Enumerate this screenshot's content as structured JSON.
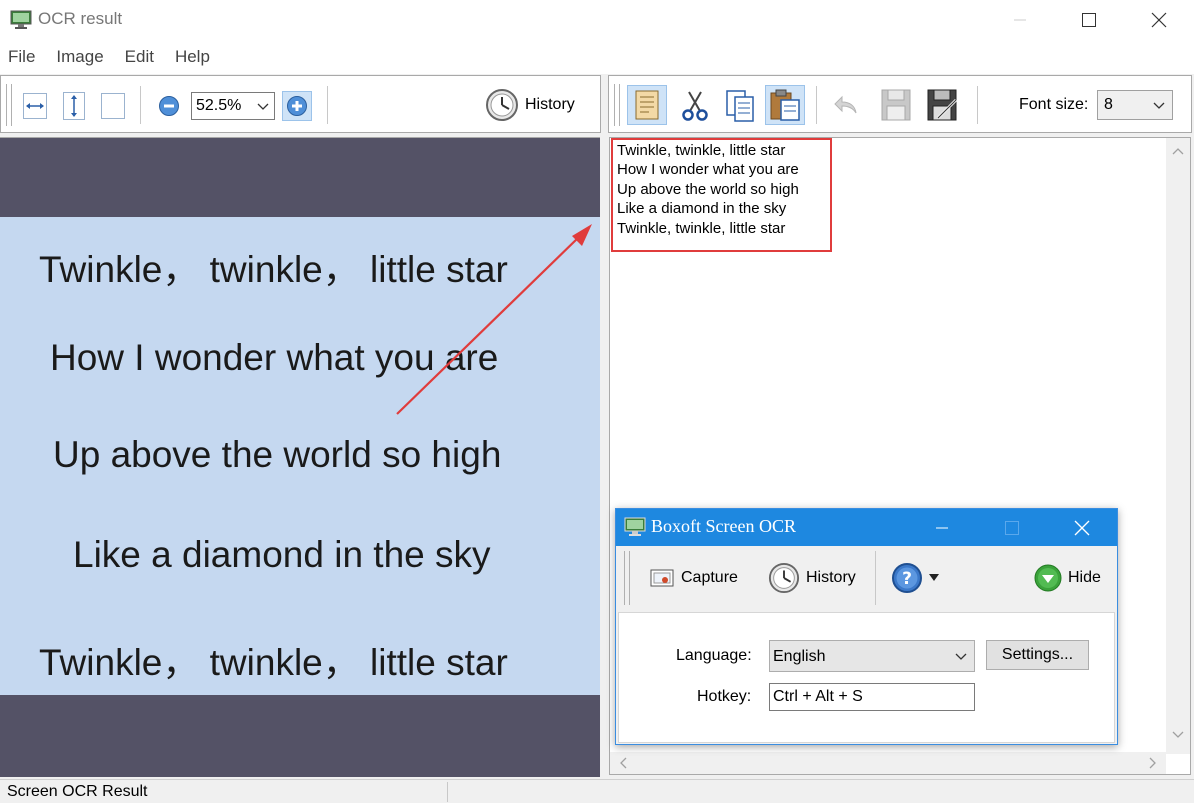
{
  "window": {
    "title": "OCR result"
  },
  "menu": {
    "items": [
      "File",
      "Image",
      "Edit",
      "Help"
    ]
  },
  "toolbar_left": {
    "zoom_value": "52.5%",
    "history_label": "History"
  },
  "toolbar_right": {
    "font_size_label": "Font size:",
    "font_size_value": "8"
  },
  "image_text": {
    "lines": [
      "Twinkle， twinkle， little star",
      "How I wonder what you are",
      "Up above the world so high",
      "Like a diamond in the sky",
      "Twinkle， twinkle， little star"
    ]
  },
  "ocr_text": {
    "lines": [
      "Twinkle, twinkle, little star",
      "How I wonder what you are",
      "Up above the world so high",
      "Like a diamond in the sky",
      "Twinkle, twinkle, little star"
    ]
  },
  "ocr_window": {
    "title": "Boxoft Screen OCR",
    "capture_label": "Capture",
    "history_label": "History",
    "hide_label": "Hide",
    "language_label": "Language:",
    "language_value": "English",
    "settings_label": "Settings...",
    "hotkey_label": "Hotkey:",
    "hotkey_value": "Ctrl + Alt + S"
  },
  "status": {
    "text": "Screen OCR Result"
  },
  "colors": {
    "accent": "#1e88e0",
    "highlight_border": "#e03c3c",
    "image_bg": "#c5d8f0",
    "image_frame": "#545266"
  }
}
